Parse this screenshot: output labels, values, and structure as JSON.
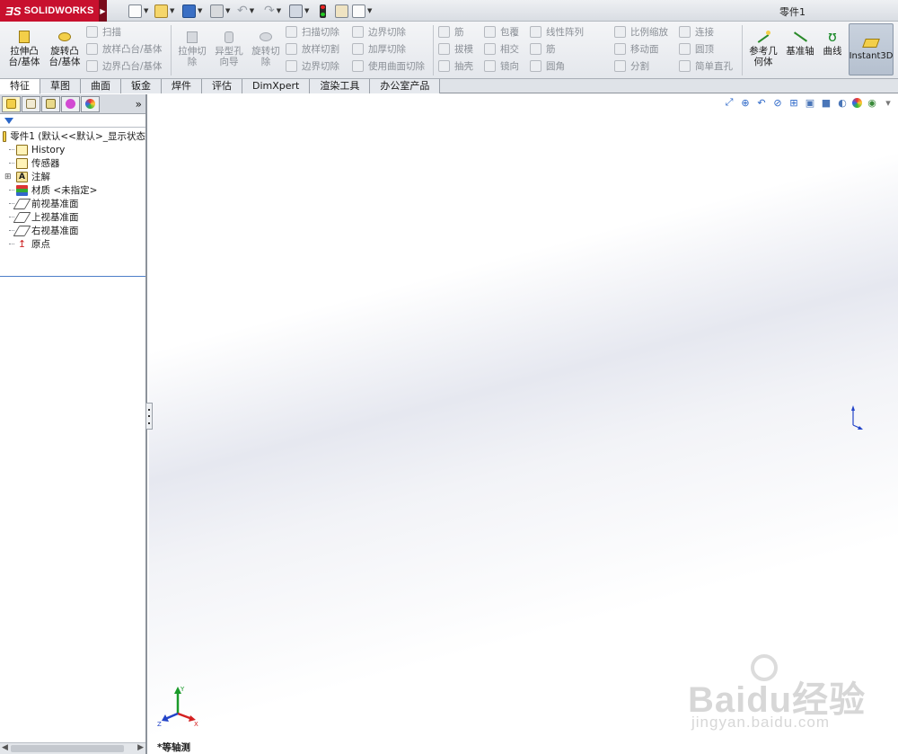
{
  "app": {
    "brand_logo": "SOLIDWORKS",
    "document_title": "零件1"
  },
  "ribbon": {
    "extrude_boss": "拉伸凸\n台/基体",
    "revolve_boss": "旋转凸\n台/基体",
    "sweep": "扫描",
    "loft_boss": "放样凸台/基体",
    "boundary_boss": "边界凸台/基体",
    "extrude_cut": "拉伸切\n除",
    "hole_wizard": "异型孔\n向导",
    "revolve_cut": "旋转切\n除",
    "swept_cut": "扫描切除",
    "lofted_cut": "放样切割",
    "boundary_cut_1": "边界切除",
    "boundary_cut_2": "边界切除",
    "thicken_cut": "加厚切除",
    "surface_cut": "使用曲面切除",
    "rib": "筋",
    "draft": "拔模",
    "shell": "抽壳",
    "wrap": "包覆",
    "intersect": "相交",
    "mirror": "镜向",
    "linear_pattern": "线性阵列",
    "rib2": "筋",
    "fillet": "圆角",
    "scale": "比例缩放",
    "move_face": "移动面",
    "split": "分割",
    "connect": "连接",
    "dome": "圆顶",
    "simple_hole": "简单直孔",
    "ref_geometry": "参考几\n何体",
    "datum_axis": "基准轴",
    "curves": "曲线",
    "instant3d": "Instant3D"
  },
  "tabs": [
    "特征",
    "草图",
    "曲面",
    "钣金",
    "焊件",
    "评估",
    "DimXpert",
    "渲染工具",
    "办公室产品"
  ],
  "tree": {
    "root": "零件1 (默认<<默认>_显示状态",
    "items": [
      "History",
      "传感器",
      "注解",
      "材质 <未指定>",
      "前视基准面",
      "上视基准面",
      "右视基准面",
      "原点"
    ]
  },
  "viewport": {
    "view_orientation": "*等轴测"
  },
  "watermark": {
    "brand": "Baidu经验",
    "url": "jingyan.baidu.com"
  },
  "colors": {
    "logo_red": "#c8102e",
    "axis_x": "#d42020",
    "axis_y": "#1a9a2a",
    "axis_z": "#2344c8"
  }
}
